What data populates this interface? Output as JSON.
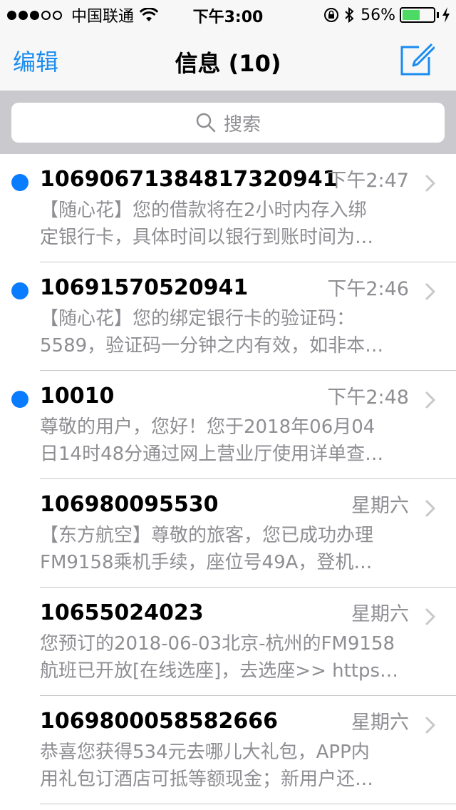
{
  "status_bar": {
    "carrier": "中国联通",
    "time": "下午3:00",
    "battery_percent_text": "56%",
    "battery_level": 0.56,
    "battery_color": "#4cd964",
    "icons": [
      "signal-dots",
      "wifi-icon",
      "orientation-lock-icon",
      "bluetooth-icon",
      "battery-icon",
      "charging-icon"
    ]
  },
  "nav": {
    "edit_label": "编辑",
    "title": "信息 (10)",
    "compose_icon": "compose-icon",
    "accent_color": "#1a8cf0"
  },
  "search": {
    "placeholder": "搜索"
  },
  "messages": [
    {
      "sender": "10690671384817320941",
      "time": "下午2:47",
      "unread": true,
      "preview_line1": "【随心花】您的借款将在2小时内存入绑",
      "preview_line2": "定银行卡，具体时间以银行到账时间为…"
    },
    {
      "sender": "10691570520941",
      "time": "下午2:46",
      "unread": true,
      "preview_line1": "【随心花】您的绑定银行卡的验证码：",
      "preview_line2": "5589，验证码一分钟之内有效，如非本…"
    },
    {
      "sender": "10010",
      "time": "下午2:48",
      "unread": true,
      "preview_line1": "尊敬的用户，您好！您于2018年06月04",
      "preview_line2": "日14时48分通过网上营业厅使用详单查…"
    },
    {
      "sender": "106980095530",
      "time": "星期六",
      "unread": false,
      "preview_line1": "【东方航空】尊敬的旅客，您已成功办理",
      "preview_line2": "FM9158乘机手续，座位号49A，登机…"
    },
    {
      "sender": "10655024023",
      "time": "星期六",
      "unread": false,
      "preview_line1": "您预订的2018-06-03北京-杭州的FM9158",
      "preview_line2": "航班已开放[在线选座]，去选座>> https…"
    },
    {
      "sender": "1069800058582666",
      "time": "星期六",
      "unread": false,
      "preview_line1": "恭喜您获得534元去哪儿大礼包，APP内",
      "preview_line2": "用礼包订酒店可抵等额现金；新用户还…"
    }
  ]
}
